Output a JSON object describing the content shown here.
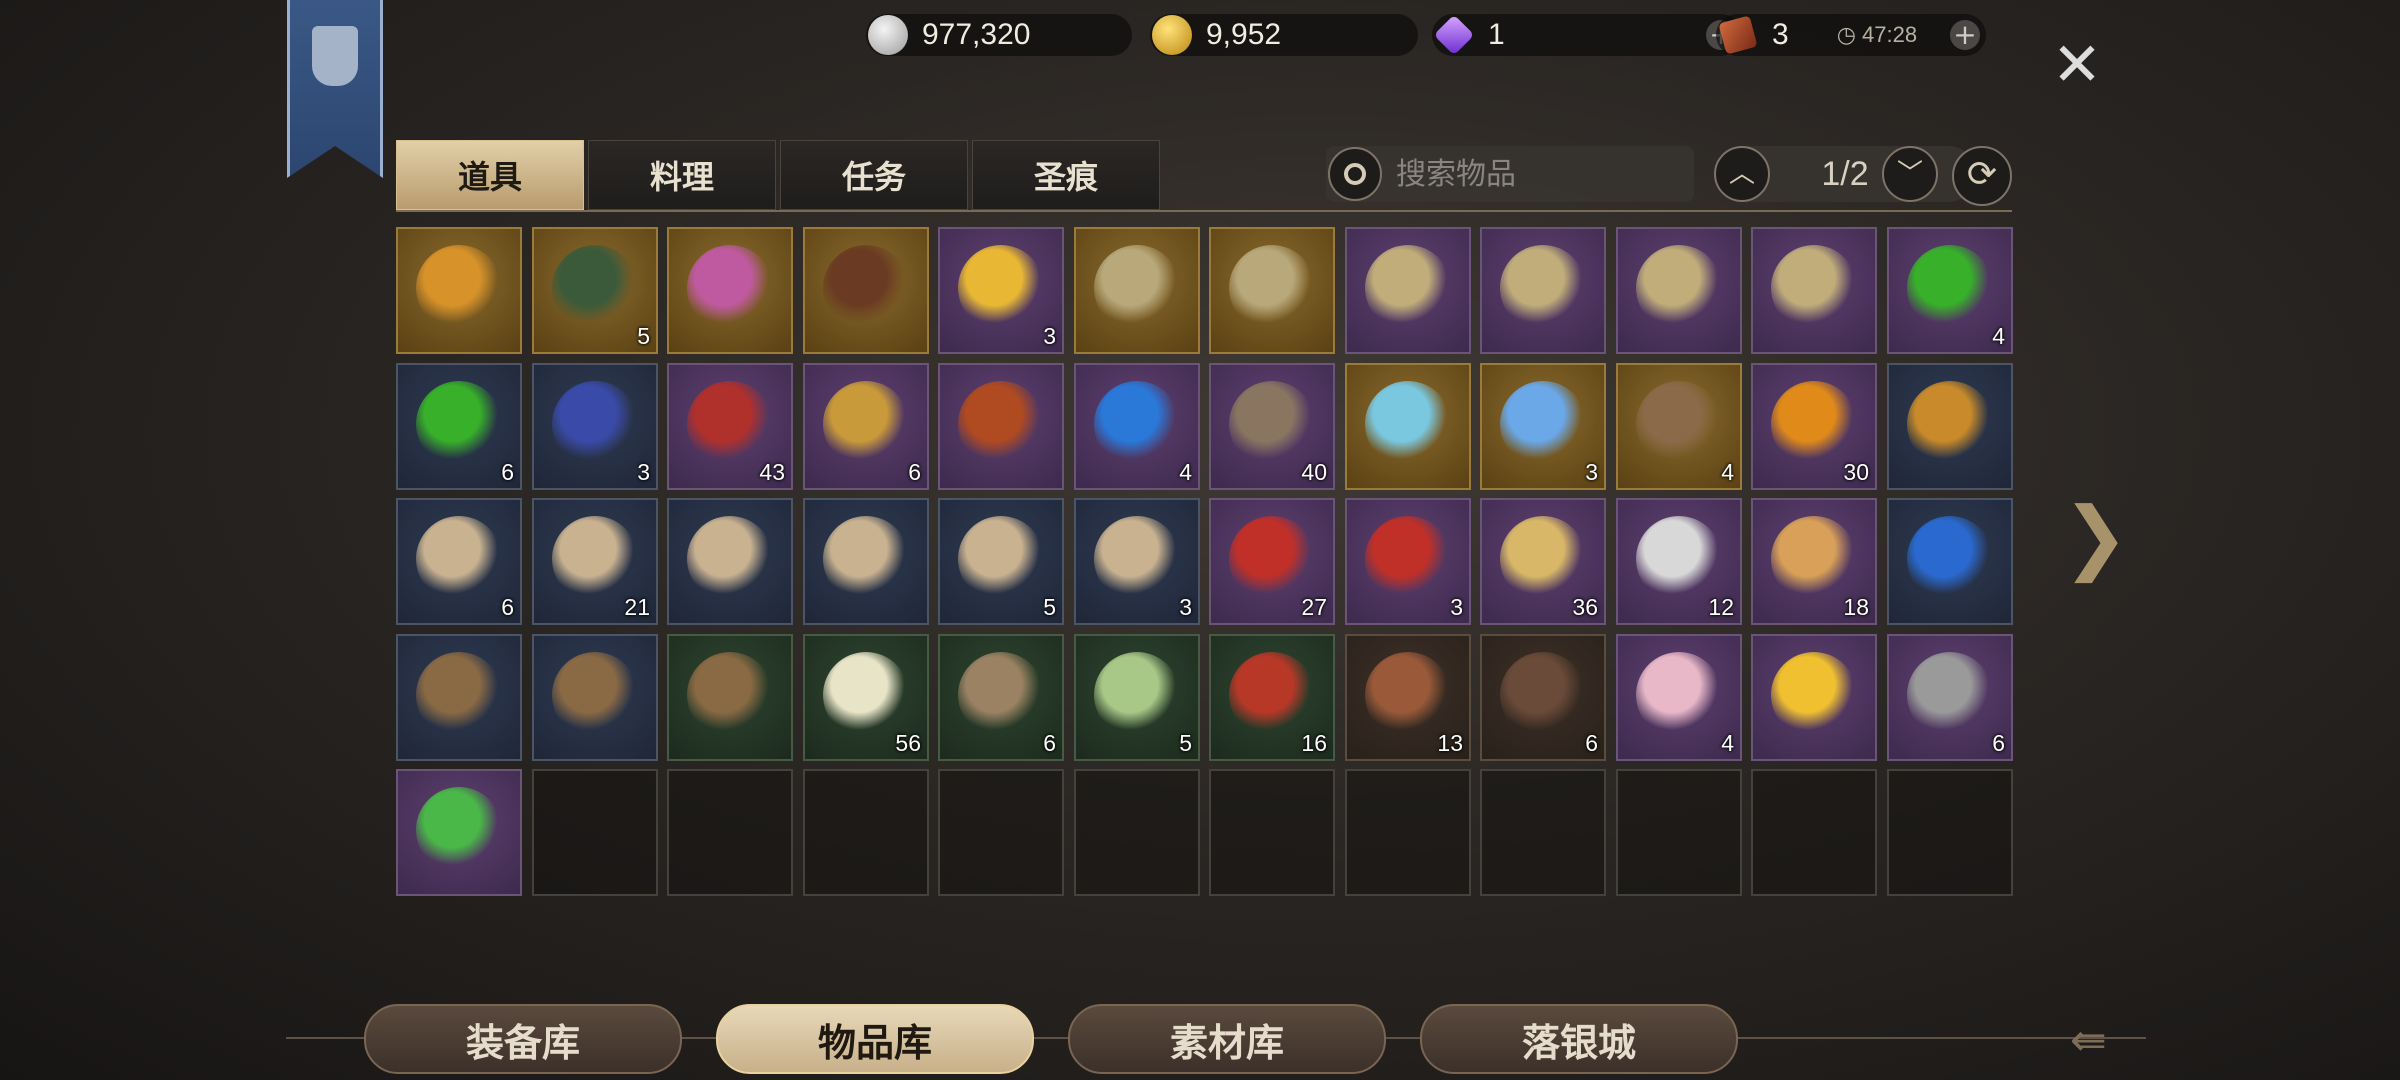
{
  "currencies": {
    "silver": {
      "icon": "silver-coin-icon",
      "value": "977,320",
      "color": "#c8c8c8"
    },
    "gold": {
      "icon": "gold-coin-icon",
      "value": "9,952",
      "color": "#d9a521"
    },
    "gem": {
      "icon": "diamond-icon",
      "value": "1",
      "color": "#9b5cf0"
    },
    "ticket": {
      "icon": "ticket-icon",
      "value": "3",
      "timer": "47:28",
      "color": "#b84a2c"
    }
  },
  "tabs": [
    {
      "label": "道具",
      "active": true
    },
    {
      "label": "料理",
      "active": false
    },
    {
      "label": "任务",
      "active": false
    },
    {
      "label": "圣痕",
      "active": false
    }
  ],
  "search": {
    "placeholder": "搜索物品"
  },
  "pager": {
    "text": "1/2"
  },
  "items": [
    {
      "bg": "gold",
      "icon": "coin-pouch-icon",
      "color": "#d8922a",
      "count": ""
    },
    {
      "bg": "gold",
      "icon": "compass-amulet-icon",
      "color": "#3b5a3a",
      "count": "5"
    },
    {
      "bg": "gold",
      "icon": "feather-scroll-icon",
      "color": "#c05aa0",
      "count": ""
    },
    {
      "bg": "gold",
      "icon": "chest-icon",
      "color": "#6a3b22",
      "count": ""
    },
    {
      "bg": "purple",
      "icon": "bell-icon",
      "color": "#e8b834",
      "count": "3"
    },
    {
      "bg": "gold",
      "icon": "treasure-map-icon",
      "color": "#b8a87a",
      "count": ""
    },
    {
      "bg": "gold",
      "icon": "treasure-map-icon",
      "color": "#b8a87a",
      "count": ""
    },
    {
      "bg": "purple",
      "icon": "map-scroll-icon",
      "color": "#c0ad7a",
      "count": ""
    },
    {
      "bg": "purple",
      "icon": "map-scroll-icon",
      "color": "#c0ad7a",
      "count": ""
    },
    {
      "bg": "purple",
      "icon": "map-scroll-icon",
      "color": "#c0ad7a",
      "count": ""
    },
    {
      "bg": "purple",
      "icon": "map-scroll-icon",
      "color": "#c0ad7a",
      "count": ""
    },
    {
      "bg": "purple",
      "icon": "green-potion-icon",
      "color": "#38b02a",
      "count": "4"
    },
    {
      "bg": "blue",
      "icon": "green-potion-icon",
      "color": "#38b02a",
      "count": "6"
    },
    {
      "bg": "blue",
      "icon": "voucher-10-icon",
      "color": "#3a4aa8",
      "count": "3"
    },
    {
      "bg": "purple",
      "icon": "red-ticket-icon",
      "color": "#b0302c",
      "count": "43"
    },
    {
      "bg": "purple",
      "icon": "medal-icon",
      "color": "#c89a3a",
      "count": "6"
    },
    {
      "bg": "purple",
      "icon": "quill-feather-icon",
      "color": "#b04a20",
      "count": ""
    },
    {
      "bg": "purple",
      "icon": "butterfly-icon",
      "color": "#2a78d8",
      "count": "4"
    },
    {
      "bg": "purple",
      "icon": "backpack-icon",
      "color": "#8a7660",
      "count": "40"
    },
    {
      "bg": "gold",
      "icon": "crystal-icon",
      "color": "#7ac8e0",
      "count": ""
    },
    {
      "bg": "gold",
      "icon": "crystal-icon",
      "color": "#6aa8e8",
      "count": "3"
    },
    {
      "bg": "gold",
      "icon": "owl-token-icon",
      "color": "#8a6a48",
      "count": "4"
    },
    {
      "bg": "purple",
      "icon": "emblem-token-icon",
      "color": "#e08a1a",
      "count": "30"
    },
    {
      "bg": "blue",
      "icon": "amber-ore-icon",
      "color": "#c88a2a",
      "count": ""
    },
    {
      "bg": "blue",
      "icon": "bow-parchment-icon",
      "color": "#c9b290",
      "count": "6"
    },
    {
      "bg": "blue",
      "icon": "crossbow-parchment-icon",
      "color": "#c9b290",
      "count": "21"
    },
    {
      "bg": "blue",
      "icon": "staff-parchment-icon",
      "color": "#c9b290",
      "count": ""
    },
    {
      "bg": "blue",
      "icon": "gauntlet-parchment-icon",
      "color": "#c9b290",
      "count": ""
    },
    {
      "bg": "blue",
      "icon": "sword-parchment-icon",
      "color": "#c9b290",
      "count": "5"
    },
    {
      "bg": "blue",
      "icon": "crossbow-parchment-icon",
      "color": "#c9b290",
      "count": "3"
    },
    {
      "bg": "purple",
      "icon": "lotus-ticket-icon",
      "color": "#c03028",
      "count": "27"
    },
    {
      "bg": "purple",
      "icon": "lotus-ticket-icon",
      "color": "#c03028",
      "count": "3"
    },
    {
      "bg": "purple",
      "icon": "yellow-candle-icon",
      "color": "#d8b868",
      "count": "36"
    },
    {
      "bg": "purple",
      "icon": "white-candle-icon",
      "color": "#d8d8d8",
      "count": "12"
    },
    {
      "bg": "purple",
      "icon": "orange-candle-icon",
      "color": "#d8a058",
      "count": "18"
    },
    {
      "bg": "blue",
      "icon": "blue-cone-icon",
      "color": "#2a6ad0",
      "count": ""
    },
    {
      "bg": "blue",
      "icon": "fishing-rod-icon",
      "color": "#8a6a44",
      "count": ""
    },
    {
      "bg": "blue",
      "icon": "fishing-rod-icon",
      "color": "#8a6a44",
      "count": ""
    },
    {
      "bg": "green",
      "icon": "fishing-rod-icon",
      "color": "#8a6a44",
      "count": ""
    },
    {
      "bg": "green",
      "icon": "grub-icon",
      "color": "#e8e4c8",
      "count": "56"
    },
    {
      "bg": "green",
      "icon": "centipede-icon",
      "color": "#9a8262",
      "count": "6"
    },
    {
      "bg": "green",
      "icon": "green-grub-icon",
      "color": "#a8c888",
      "count": "5"
    },
    {
      "bg": "green",
      "icon": "red-worm-icon",
      "color": "#b83828",
      "count": "16"
    },
    {
      "bg": "brown",
      "icon": "earthworm-icon",
      "color": "#9a5a3a",
      "count": "13"
    },
    {
      "bg": "brown",
      "icon": "boot-icon",
      "color": "#6a4a38",
      "count": "6"
    },
    {
      "bg": "purple",
      "icon": "seashell-icon",
      "color": "#e8b8c8",
      "count": "4"
    },
    {
      "bg": "purple",
      "icon": "rubber-duck-icon",
      "color": "#f0c030",
      "count": ""
    },
    {
      "bg": "purple",
      "icon": "dagger-icon",
      "color": "#9a9a9a",
      "count": "6"
    },
    {
      "bg": "purple",
      "icon": "green-gem-icon",
      "color": "#4ab848",
      "count": ""
    },
    {
      "bg": "empty",
      "icon": "",
      "color": "",
      "count": ""
    },
    {
      "bg": "empty",
      "icon": "",
      "color": "",
      "count": ""
    },
    {
      "bg": "empty",
      "icon": "",
      "color": "",
      "count": ""
    },
    {
      "bg": "empty",
      "icon": "",
      "color": "",
      "count": ""
    },
    {
      "bg": "empty",
      "icon": "",
      "color": "",
      "count": ""
    },
    {
      "bg": "empty",
      "icon": "",
      "color": "",
      "count": ""
    },
    {
      "bg": "empty",
      "icon": "",
      "color": "",
      "count": ""
    },
    {
      "bg": "empty",
      "icon": "",
      "color": "",
      "count": ""
    },
    {
      "bg": "empty",
      "icon": "",
      "color": "",
      "count": ""
    },
    {
      "bg": "empty",
      "icon": "",
      "color": "",
      "count": ""
    },
    {
      "bg": "empty",
      "icon": "",
      "color": "",
      "count": ""
    }
  ],
  "bottom_tabs": [
    {
      "label": "装备库",
      "active": false
    },
    {
      "label": "物品库",
      "active": true
    },
    {
      "label": "素材库",
      "active": false
    },
    {
      "label": "落银城",
      "active": false
    }
  ]
}
